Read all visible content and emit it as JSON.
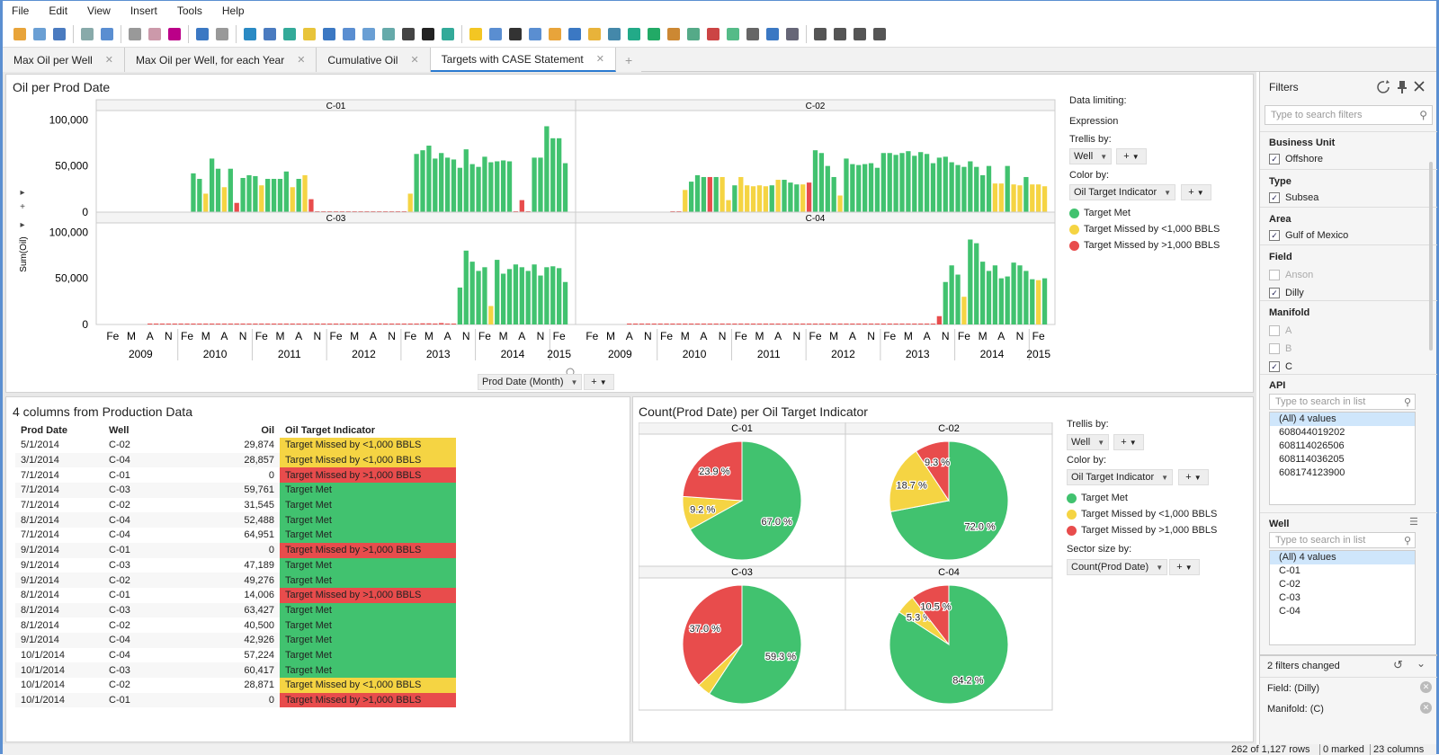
{
  "menu": [
    "File",
    "Edit",
    "View",
    "Insert",
    "Tools",
    "Help"
  ],
  "toolbar_icons": [
    "open-icon",
    "add-data-icon",
    "link-icon",
    "save-icon",
    "print-icon",
    "export-icon",
    "copy-icon",
    "paste-icon",
    "undo-icon",
    "redo-icon",
    "reset-icon",
    "filter-icon",
    "details-icon",
    "tags-icon",
    "bookmark-icon",
    "table-icon",
    "cross-table-icon",
    "graphical-table-icon",
    "text-area-icon",
    "color-icon",
    "import-icon",
    "lightbulb-icon",
    "data-table-icon",
    "sum-icon",
    "summary-icon",
    "bar-chart-icon",
    "line-chart-icon",
    "pie-chart-icon",
    "scatter-icon",
    "3d-scatter-icon",
    "map-icon",
    "treemap-icon",
    "combination-icon",
    "parallel-icon",
    "heatmap-icon",
    "box-plot-icon",
    "text-icon",
    "settings-icon",
    "layout-1-icon",
    "layout-2-icon",
    "layout-3-icon",
    "layout-4-icon"
  ],
  "tabs": [
    {
      "label": "Max Oil per Well"
    },
    {
      "label": "Max Oil per Well, for each Year"
    },
    {
      "label": "Cumulative Oil"
    },
    {
      "label": "Targets with CASE Statement",
      "active": true
    }
  ],
  "colors": {
    "met": "#41c26f",
    "missed_lt": "#f5d443",
    "missed_gt": "#e84c4c",
    "gray": "#d6d6d6"
  },
  "bar_panel": {
    "title": "Oil per Prod Date",
    "y_label": "Sum(Oil)",
    "y_ticks": [
      "100,000",
      "50,000",
      "0"
    ],
    "month_ticks": [
      "Fe",
      "M",
      "A",
      "N"
    ],
    "years": [
      "2009",
      "2010",
      "2011",
      "2012",
      "2013",
      "2014",
      "2015"
    ],
    "x_axis_selector": "Prod Date (Month)",
    "sidebar": {
      "data_limiting": "Data limiting:",
      "expression": "Expression",
      "trellis_label": "Trellis by:",
      "trellis_value": "Well",
      "color_label": "Color by:",
      "color_value": "Oil Target Indicator",
      "plus": "+"
    }
  },
  "chart_data": [
    {
      "type": "bar",
      "title": "Oil per Prod Date",
      "ylabel": "Sum(Oil)",
      "ylim": [
        0,
        110000
      ],
      "x_range": [
        "2009-01",
        "2015-03"
      ],
      "legend": [
        "Target Met",
        "Target Missed by <1,000 BBLS",
        "Target Missed by >1,000 BBLS"
      ],
      "panels": [
        {
          "name": "C-01",
          "values": [
            42000,
            36000,
            20000,
            58000,
            47000,
            27000,
            47000,
            10000,
            37000,
            40000,
            39000,
            29000,
            36000,
            36000,
            36000,
            44000,
            27000,
            36000,
            40000,
            14000,
            300,
            300,
            300,
            300,
            300,
            300,
            300,
            300,
            300,
            300,
            300,
            300,
            300,
            300,
            300,
            20000,
            63000,
            67000,
            72000,
            58000,
            64000,
            59000,
            57000,
            48000,
            68000,
            52000,
            49000,
            60000,
            54000,
            55000,
            56000,
            55000,
            600,
            13000,
            600,
            59000,
            59000,
            93000,
            80000,
            80000,
            53000
          ],
          "colors": [
            0,
            0,
            1,
            0,
            0,
            1,
            0,
            2,
            0,
            0,
            0,
            1,
            0,
            0,
            0,
            0,
            1,
            0,
            1,
            2,
            2,
            2,
            2,
            2,
            2,
            2,
            2,
            2,
            2,
            2,
            2,
            2,
            2,
            2,
            2,
            1,
            0,
            0,
            0,
            0,
            0,
            0,
            0,
            0,
            0,
            0,
            0,
            0,
            0,
            0,
            0,
            0,
            2,
            2,
            2,
            0,
            0,
            0,
            0,
            0,
            0
          ]
        },
        {
          "name": "C-02",
          "values": [
            500,
            500,
            24000,
            33000,
            40000,
            38000,
            38000,
            38000,
            38000,
            13000,
            29000,
            38000,
            29000,
            28000,
            29000,
            28000,
            29000,
            35000,
            35000,
            32000,
            30000,
            30000,
            32000,
            67000,
            64000,
            50000,
            38000,
            18000,
            58000,
            52000,
            51000,
            52000,
            53000,
            48000,
            64000,
            64000,
            62000,
            64000,
            66000,
            61000,
            65000,
            63000,
            53000,
            59000,
            60000,
            54000,
            51000,
            49000,
            55000,
            49000,
            40000,
            50000,
            31000,
            31000,
            50000,
            30000,
            29000,
            38000,
            30000,
            30000,
            28000
          ],
          "colors": [
            2,
            2,
            1,
            0,
            0,
            0,
            2,
            0,
            1,
            1,
            0,
            1,
            1,
            1,
            1,
            1,
            0,
            1,
            0,
            0,
            0,
            1,
            2,
            0,
            0,
            0,
            0,
            1,
            0,
            0,
            0,
            0,
            0,
            0,
            0,
            0,
            0,
            0,
            0,
            0,
            0,
            0,
            0,
            0,
            0,
            0,
            0,
            0,
            0,
            0,
            0,
            0,
            1,
            1,
            0,
            1,
            1,
            0,
            1,
            1,
            1
          ]
        },
        {
          "name": "C-03",
          "values": [
            0,
            0,
            0,
            0,
            0,
            0,
            0,
            0,
            0,
            0,
            0,
            0,
            0,
            0,
            0,
            0,
            0,
            0,
            0,
            0,
            0,
            0,
            0,
            0,
            0,
            0,
            0,
            0,
            0,
            0,
            0,
            0,
            0,
            0,
            0,
            0,
            0,
            0,
            0,
            0,
            800,
            800,
            800,
            800,
            1200,
            1200,
            1000,
            1500,
            800,
            800,
            40000,
            80000,
            68000,
            58000,
            62000,
            20000,
            70000,
            55000,
            60000,
            65000,
            62000,
            58000,
            65000,
            53000,
            62000,
            63000,
            61000,
            46000
          ],
          "colors": [
            2,
            2,
            2,
            2,
            2,
            2,
            2,
            2,
            2,
            2,
            2,
            2,
            2,
            2,
            2,
            2,
            2,
            2,
            2,
            2,
            2,
            2,
            2,
            2,
            2,
            2,
            2,
            2,
            2,
            2,
            2,
            2,
            2,
            2,
            2,
            2,
            2,
            2,
            2,
            2,
            2,
            2,
            2,
            2,
            2,
            2,
            2,
            2,
            2,
            2,
            0,
            0,
            0,
            0,
            0,
            1,
            0,
            0,
            0,
            0,
            0,
            0,
            0,
            0,
            0,
            0,
            0,
            0
          ]
        },
        {
          "name": "C-04",
          "values": [
            0,
            0,
            0,
            0,
            0,
            0,
            0,
            0,
            0,
            0,
            0,
            0,
            0,
            0,
            0,
            0,
            0,
            0,
            0,
            0,
            0,
            0,
            0,
            0,
            0,
            0,
            0,
            0,
            0,
            0,
            0,
            0,
            0,
            0,
            0,
            0,
            0,
            0,
            0,
            0,
            0,
            0,
            0,
            0,
            0,
            0,
            0,
            0,
            0,
            0,
            9000,
            46000,
            64000,
            54000,
            30000,
            92000,
            88000,
            68000,
            58000,
            64000,
            50000,
            52000,
            67000,
            64000,
            58000,
            49000,
            48000,
            50000
          ],
          "colors": [
            2,
            2,
            2,
            2,
            2,
            2,
            2,
            2,
            2,
            2,
            2,
            2,
            2,
            2,
            2,
            2,
            2,
            2,
            2,
            2,
            2,
            2,
            2,
            2,
            2,
            2,
            2,
            2,
            2,
            2,
            2,
            2,
            2,
            2,
            2,
            2,
            2,
            2,
            2,
            2,
            2,
            2,
            2,
            2,
            2,
            2,
            2,
            2,
            2,
            2,
            2,
            0,
            0,
            0,
            1,
            0,
            0,
            0,
            0,
            0,
            0,
            0,
            0,
            0,
            0,
            0,
            1,
            0
          ]
        }
      ]
    },
    {
      "type": "pie",
      "title": "Count(Prod Date) per Oil Target Indicator",
      "legend": [
        "Target Met",
        "Target Missed by <1,000 BBLS",
        "Target Missed by >1,000 BBLS"
      ],
      "panels": [
        {
          "name": "C-01",
          "slices": [
            {
              "label": "Target Met",
              "value": 67.0,
              "text": "67.0 %"
            },
            {
              "label": "Target Missed by <1,000 BBLS",
              "value": 9.2,
              "text": "9.2 %"
            },
            {
              "label": "Target Missed by >1,000 BBLS",
              "value": 23.9,
              "text": "23.9 %"
            }
          ]
        },
        {
          "name": "C-02",
          "slices": [
            {
              "label": "Target Met",
              "value": 72.0,
              "text": "72.0 %"
            },
            {
              "label": "Target Missed by <1,000 BBLS",
              "value": 18.7,
              "text": "18.7 %"
            },
            {
              "label": "Target Missed by >1,000 BBLS",
              "value": 9.3,
              "text": "9.3 %"
            }
          ]
        },
        {
          "name": "C-03",
          "slices": [
            {
              "label": "Target Met",
              "value": 59.3,
              "text": "59.3 %"
            },
            {
              "label": "Target Missed by <1,000 BBLS",
              "value": 3.7,
              "text": ""
            },
            {
              "label": "Target Missed by >1,000 BBLS",
              "value": 37.0,
              "text": "37.0 %"
            }
          ]
        },
        {
          "name": "C-04",
          "slices": [
            {
              "label": "Target Met",
              "value": 84.2,
              "text": "84.2 %"
            },
            {
              "label": "Target Missed by <1,000 BBLS",
              "value": 5.3,
              "text": "5.3 %"
            },
            {
              "label": "Target Missed by >1,000 BBLS",
              "value": 10.5,
              "text": "10.5 %"
            }
          ]
        }
      ]
    }
  ],
  "table_panel": {
    "title": "4 columns from Production Data",
    "columns": [
      "Prod Date",
      "Well",
      "Oil",
      "Oil Target Indicator"
    ],
    "rows": [
      [
        "5/1/2014",
        "C-02",
        "29,874",
        "Target Missed by <1,000 BBLS"
      ],
      [
        "3/1/2014",
        "C-04",
        "28,857",
        "Target Missed by <1,000 BBLS"
      ],
      [
        "7/1/2014",
        "C-01",
        "0",
        "Target Missed by >1,000 BBLS"
      ],
      [
        "7/1/2014",
        "C-03",
        "59,761",
        "Target Met"
      ],
      [
        "7/1/2014",
        "C-02",
        "31,545",
        "Target Met"
      ],
      [
        "8/1/2014",
        "C-04",
        "52,488",
        "Target Met"
      ],
      [
        "7/1/2014",
        "C-04",
        "64,951",
        "Target Met"
      ],
      [
        "9/1/2014",
        "C-01",
        "0",
        "Target Missed by >1,000 BBLS"
      ],
      [
        "9/1/2014",
        "C-03",
        "47,189",
        "Target Met"
      ],
      [
        "9/1/2014",
        "C-02",
        "49,276",
        "Target Met"
      ],
      [
        "8/1/2014",
        "C-01",
        "14,006",
        "Target Missed by >1,000 BBLS"
      ],
      [
        "8/1/2014",
        "C-03",
        "63,427",
        "Target Met"
      ],
      [
        "8/1/2014",
        "C-02",
        "40,500",
        "Target Met"
      ],
      [
        "9/1/2014",
        "C-04",
        "42,926",
        "Target Met"
      ],
      [
        "10/1/2014",
        "C-04",
        "57,224",
        "Target Met"
      ],
      [
        "10/1/2014",
        "C-03",
        "60,417",
        "Target Met"
      ],
      [
        "10/1/2014",
        "C-02",
        "28,871",
        "Target Missed by <1,000 BBLS"
      ],
      [
        "10/1/2014",
        "C-01",
        "0",
        "Target Missed by >1,000 BBLS"
      ]
    ]
  },
  "pie_panel": {
    "title": "Count(Prod Date) per Oil Target Indicator",
    "trellis_label": "Trellis by:",
    "trellis_value": "Well",
    "color_label": "Color by:",
    "color_value": "Oil Target Indicator",
    "sector_label": "Sector size by:",
    "sector_value": "Count(Prod Date)",
    "plus": "+"
  },
  "filters": {
    "title": "Filters",
    "search_placeholder": "Type to search filters",
    "business_unit": {
      "label": "Business Unit",
      "items": [
        {
          "label": "Offshore",
          "checked": true
        }
      ]
    },
    "type": {
      "label": "Type",
      "items": [
        {
          "label": "Subsea",
          "checked": true
        }
      ]
    },
    "area": {
      "label": "Area",
      "items": [
        {
          "label": "Gulf of Mexico",
          "checked": true
        }
      ]
    },
    "field": {
      "label": "Field",
      "items": [
        {
          "label": "Anson",
          "checked": false
        },
        {
          "label": "Dilly",
          "checked": true
        }
      ]
    },
    "manifold": {
      "label": "Manifold",
      "items": [
        {
          "label": "A",
          "checked": false
        },
        {
          "label": "B",
          "checked": false
        },
        {
          "label": "C",
          "checked": true
        }
      ]
    },
    "api": {
      "label": "API",
      "placeholder": "Type to search in list",
      "items": [
        "(All) 4 values",
        "608044019202",
        "608114026506",
        "608114036205",
        "608174123900"
      ]
    },
    "well": {
      "label": "Well",
      "placeholder": "Type to search in list",
      "items": [
        "(All) 4 values",
        "C-01",
        "C-02",
        "C-03",
        "C-04"
      ]
    },
    "changed": {
      "label": "2 filters changed",
      "items": [
        "Field: (Dilly)",
        "Manifold: (C)"
      ]
    }
  },
  "status": {
    "rows": "262 of 1,127 rows",
    "marked": "0 marked",
    "columns": "23 columns"
  }
}
